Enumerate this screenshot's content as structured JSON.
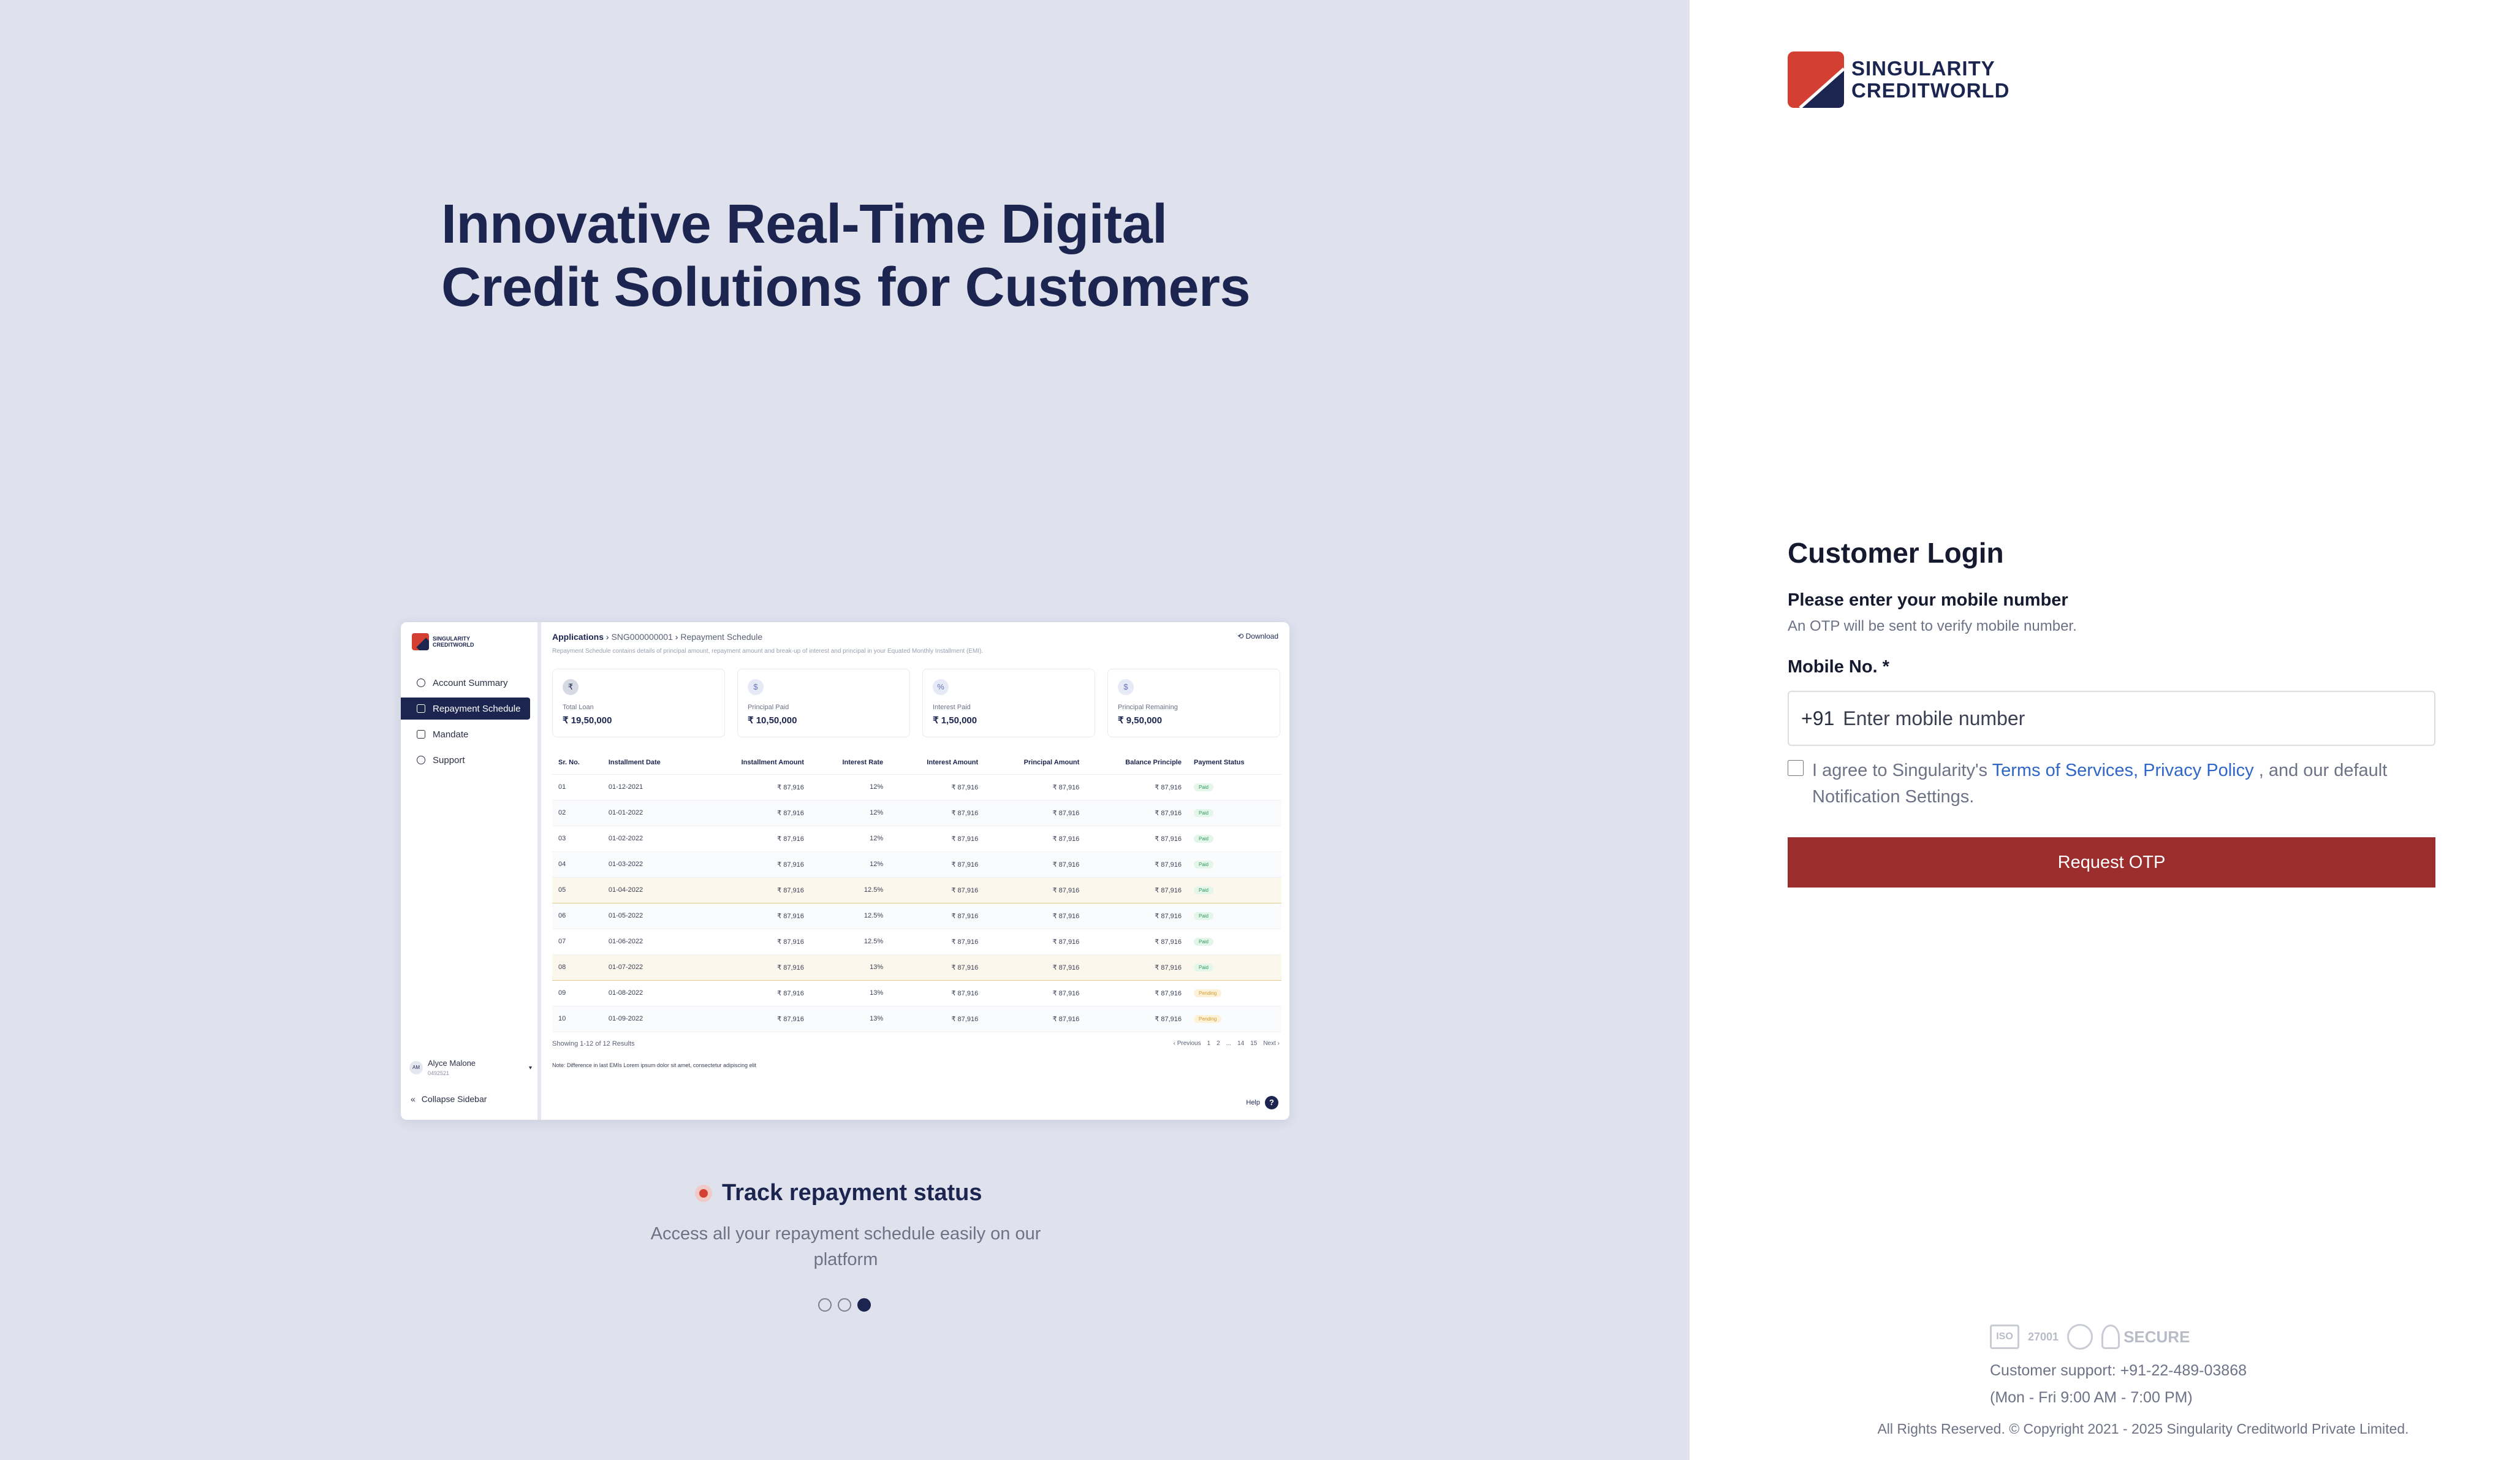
{
  "hero": {
    "title_line1": "Innovative Real-Time Digital",
    "title_line2": "Credit Solutions for Customers"
  },
  "mock": {
    "logo_line1": "SINGULARITY",
    "logo_line2": "CREDITWORLD",
    "nav": [
      {
        "label": "Account Summary",
        "icon": "user-icon"
      },
      {
        "label": "Repayment Schedule",
        "icon": "calendar-icon",
        "active": true
      },
      {
        "label": "Mandate",
        "icon": "checkbox-icon"
      },
      {
        "label": "Support",
        "icon": "help-circle-icon"
      }
    ],
    "user_initials": "AM",
    "user_name": "Alyce Malone",
    "user_id": "0492521",
    "collapse_label": "Collapse Sidebar",
    "breadcrumb": {
      "root": "Applications",
      "app_id": "SNG000000001",
      "page": "Repayment Schedule"
    },
    "description": "Repayment Schedule contains details of principal amount, repayment amount and break-up of interest and principal in your Equated Monthly Installment (EMI).",
    "download_label": "Download",
    "cards": [
      {
        "label": "Total Loan",
        "value": "₹ 19,50,000"
      },
      {
        "label": "Principal Paid",
        "value": "₹ 10,50,000"
      },
      {
        "label": "Interest Paid",
        "value": "₹ 1,50,000"
      },
      {
        "label": "Principal Remaining",
        "value": "₹ 9,50,000"
      }
    ],
    "columns": [
      "Sr. No.",
      "Installment Date",
      "Installment Amount",
      "Interest Rate",
      "Interest Amount",
      "Principal Amount",
      "Balance Principle",
      "Payment Status"
    ],
    "rows": [
      {
        "sr": "01",
        "date": "01-12-2021",
        "inst": "₹ 87,916",
        "rate": "12%",
        "int": "₹ 87,916",
        "prin": "₹ 87,916",
        "bal": "₹ 87,916",
        "status": "Paid"
      },
      {
        "sr": "02",
        "date": "01-01-2022",
        "inst": "₹ 87,916",
        "rate": "12%",
        "int": "₹ 87,916",
        "prin": "₹ 87,916",
        "bal": "₹ 87,916",
        "status": "Paid"
      },
      {
        "sr": "03",
        "date": "01-02-2022",
        "inst": "₹ 87,916",
        "rate": "12%",
        "int": "₹ 87,916",
        "prin": "₹ 87,916",
        "bal": "₹ 87,916",
        "status": "Paid"
      },
      {
        "sr": "04",
        "date": "01-03-2022",
        "inst": "₹ 87,916",
        "rate": "12%",
        "int": "₹ 87,916",
        "prin": "₹ 87,916",
        "bal": "₹ 87,916",
        "status": "Paid"
      },
      {
        "sr": "05",
        "date": "01-04-2022",
        "inst": "₹ 87,916",
        "rate": "12.5%",
        "int": "₹ 87,916",
        "prin": "₹ 87,916",
        "bal": "₹ 87,916",
        "status": "Paid",
        "highlight": true
      },
      {
        "sr": "06",
        "date": "01-05-2022",
        "inst": "₹ 87,916",
        "rate": "12.5%",
        "int": "₹ 87,916",
        "prin": "₹ 87,916",
        "bal": "₹ 87,916",
        "status": "Paid"
      },
      {
        "sr": "07",
        "date": "01-06-2022",
        "inst": "₹ 87,916",
        "rate": "12.5%",
        "int": "₹ 87,916",
        "prin": "₹ 87,916",
        "bal": "₹ 87,916",
        "status": "Paid"
      },
      {
        "sr": "08",
        "date": "01-07-2022",
        "inst": "₹ 87,916",
        "rate": "13%",
        "int": "₹ 87,916",
        "prin": "₹ 87,916",
        "bal": "₹ 87,916",
        "status": "Paid",
        "highlight": true
      },
      {
        "sr": "09",
        "date": "01-08-2022",
        "inst": "₹ 87,916",
        "rate": "13%",
        "int": "₹ 87,916",
        "prin": "₹ 87,916",
        "bal": "₹ 87,916",
        "status": "Pending"
      },
      {
        "sr": "10",
        "date": "01-09-2022",
        "inst": "₹ 87,916",
        "rate": "13%",
        "int": "₹ 87,916",
        "prin": "₹ 87,916",
        "bal": "₹ 87,916",
        "status": "Pending"
      }
    ],
    "results_text": "Showing 1-12 of 12 Results",
    "pagination": {
      "prev": "Previous",
      "pages": [
        "1",
        "2",
        "...",
        "14",
        "15"
      ],
      "next": "Next"
    },
    "note": "Note: Difference in last EMIs Lorem ipsum dolor sit amet, consectetur adipiscing elit",
    "help_label": "Help"
  },
  "feature": {
    "title": "Track repayment status",
    "description": "Access all your repayment schedule easily on our platform",
    "active_slide": 3,
    "slides": 3
  },
  "brand": {
    "line1": "SINGULARITY",
    "line2": "CREDITWORLD",
    "colors": {
      "red": "#d43f33",
      "navy": "#1c2550"
    }
  },
  "login": {
    "title": "Customer Login",
    "subtitle": "Please enter your mobile number",
    "hint": "An OTP will be sent to verify mobile number.",
    "mobile_label": "Mobile No. *",
    "country_code": "+91",
    "mobile_placeholder": "Enter mobile number",
    "agree_prefix": "I agree to Singularity's",
    "terms_link": "Terms of Services,",
    "privacy_link": "Privacy Policy",
    "agree_suffix": ", and our default Notification Settings.",
    "request_otp": "Request OTP",
    "button_color": "#9b2d2d"
  },
  "footer": {
    "cert_iso": "ISO",
    "cert_27001": "27001",
    "cert_secure": "SECURE",
    "support": "Customer support: +91-22-489-03868",
    "hours": "(Mon - Fri 9:00 AM - 7:00 PM)",
    "copyright": "All Rights Reserved. © Copyright 2021 - 2025 Singularity Creditworld Private Limited."
  }
}
